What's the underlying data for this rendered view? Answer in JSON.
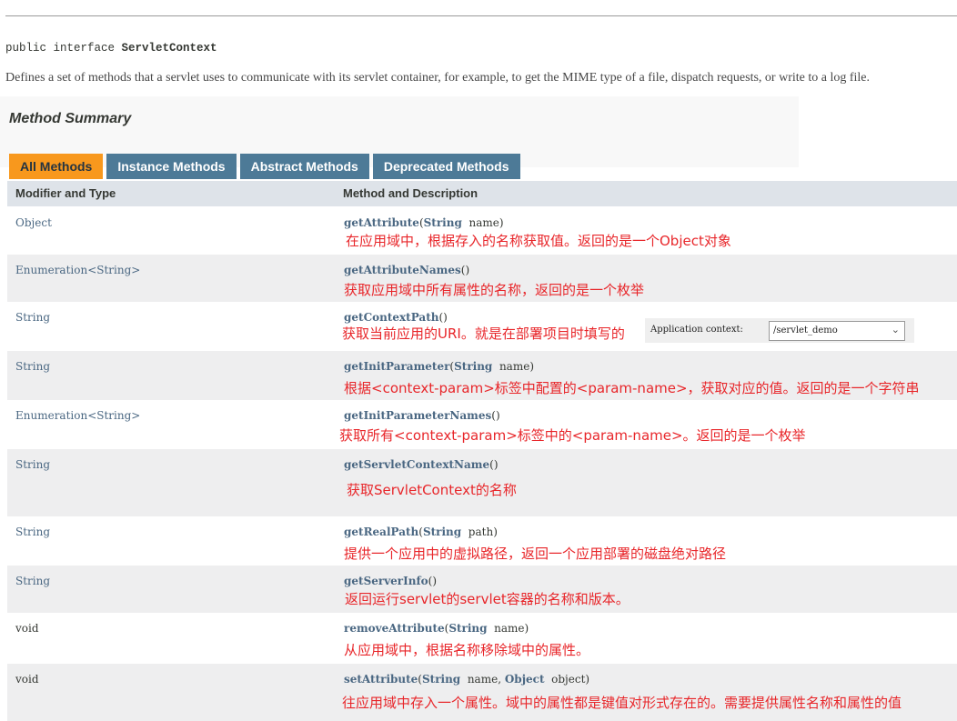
{
  "declaration": {
    "prefix": "public interface ",
    "name": "ServletContext"
  },
  "description": "Defines a set of methods that a servlet uses to communicate with its servlet container, for example, to get the MIME type of a file, dispatch requests, or write to a log file.",
  "summary_title": "Method Summary",
  "tabs": [
    "All Methods",
    "Instance Methods",
    "Abstract Methods",
    "Deprecated Methods"
  ],
  "columns": {
    "type": "Modifier and Type",
    "method": "Method and Description"
  },
  "rows": [
    {
      "type": "Object",
      "name": "getAttribute",
      "params": [
        {
          "t": "String",
          "n": "name"
        }
      ],
      "note": "在应用域中，根据存入的名称获取值。返回的是一个Object对象"
    },
    {
      "type": "Enumeration<String>",
      "name": "getAttributeNames",
      "params": [],
      "note": "获取应用域中所有属性的名称，返回的是一个枚举"
    },
    {
      "type": "String",
      "name": "getContextPath",
      "params": [],
      "note": "获取当前应用的URI。就是在部署项目时填写的"
    },
    {
      "type": "String",
      "name": "getInitParameter",
      "params": [
        {
          "t": "String",
          "n": "name"
        }
      ],
      "note": "根据<context-param>标签中配置的<param-name>，获取对应的值。返回的是一个字符串"
    },
    {
      "type": "Enumeration<String>",
      "name": "getInitParameterNames",
      "params": [],
      "note": "获取所有<context-param>标签中的<param-name>。返回的是一个枚举"
    },
    {
      "type": "String",
      "name": "getServletContextName",
      "params": [],
      "note": "获取ServletContext的名称"
    },
    {
      "type": "String",
      "name": "getRealPath",
      "params": [
        {
          "t": "String",
          "n": "path"
        }
      ],
      "note": "提供一个应用中的虚拟路径，返回一个应用部署的磁盘绝对路径"
    },
    {
      "type": "String",
      "name": "getServerInfo",
      "params": [],
      "note": "返回运行servlet的servlet容器的名称和版本。"
    },
    {
      "type": "void",
      "name": "removeAttribute",
      "params": [
        {
          "t": "String",
          "n": "name"
        }
      ],
      "note": "从应用域中，根据名称移除域中的属性。"
    },
    {
      "type": "void",
      "name": "setAttribute",
      "params": [
        {
          "t": "String",
          "n": "name"
        },
        {
          "t": "Object",
          "n": "object"
        }
      ],
      "note": "往应用域中存入一个属性。域中的属性都是键值对形式存在的。需要提供属性名称和属性的值"
    }
  ],
  "app_context": {
    "label": "Application context:",
    "value": "/servlet_demo"
  },
  "colors": {
    "active_tab": "#f8981d",
    "tab": "#4d7a97",
    "header": "#dee3e9",
    "note": "#e8262a"
  }
}
